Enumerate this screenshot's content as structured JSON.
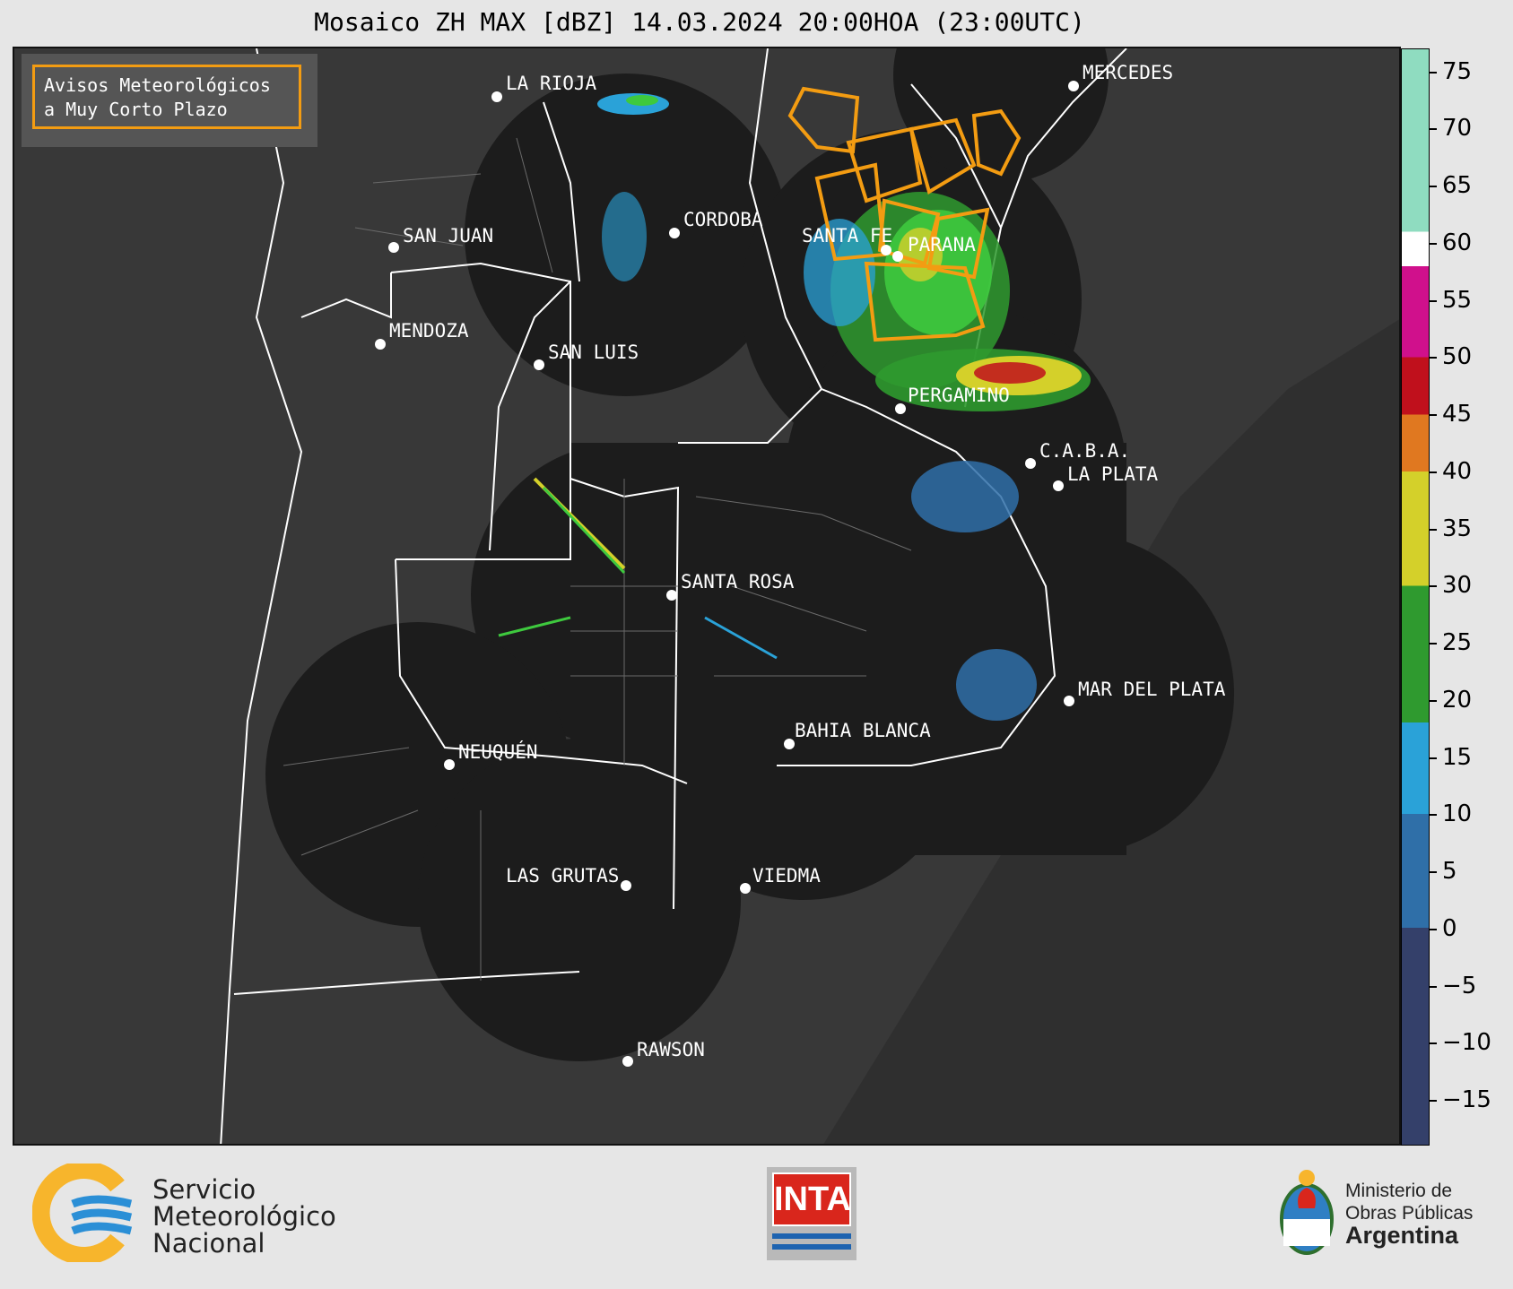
{
  "header": {
    "title": "Mosaico ZH MAX [dBZ] 14.03.2024 20:00HOA (23:00UTC)"
  },
  "alerts_box": {
    "line1": "Avisos Meteorológicos",
    "line2": "a Muy Corto Plazo",
    "border_color": "#f39c12"
  },
  "cities": [
    {
      "name": "LA RIOJA"
    },
    {
      "name": "MERCEDES"
    },
    {
      "name": "CORDOBA"
    },
    {
      "name": "SAN JUAN"
    },
    {
      "name": "SANTA FE"
    },
    {
      "name": "PARANA"
    },
    {
      "name": "MENDOZA"
    },
    {
      "name": "SAN LUIS"
    },
    {
      "name": "PERGAMINO"
    },
    {
      "name": "C.A.B.A."
    },
    {
      "name": "LA PLATA"
    },
    {
      "name": "SANTA ROSA"
    },
    {
      "name": "MAR DEL PLATA"
    },
    {
      "name": "BAHIA BLANCA"
    },
    {
      "name": "NEUQUÉN"
    },
    {
      "name": "LAS GRUTAS"
    },
    {
      "name": "VIEDMA"
    },
    {
      "name": "RAWSON"
    }
  ],
  "colorbar": {
    "unit": "dBZ",
    "min": -19,
    "max": 77,
    "ticks": [
      "75",
      "70",
      "65",
      "60",
      "55",
      "50",
      "45",
      "40",
      "35",
      "30",
      "25",
      "20",
      "15",
      "10",
      "5",
      "0",
      "−5",
      "−10",
      "−15"
    ],
    "tick_values": [
      75,
      70,
      65,
      60,
      55,
      50,
      45,
      40,
      35,
      30,
      25,
      20,
      15,
      10,
      5,
      0,
      -5,
      -10,
      -15
    ],
    "stops": [
      {
        "from": -19,
        "to": 0,
        "color": "#34406a"
      },
      {
        "from": 0,
        "to": 10,
        "color": "#2f6fa8"
      },
      {
        "from": 10,
        "to": 18,
        "color": "#2aa2d8"
      },
      {
        "from": 18,
        "to": 30,
        "color": "#2f9a2f"
      },
      {
        "from": 30,
        "to": 40,
        "color": "#d4d02a"
      },
      {
        "from": 40,
        "to": 45,
        "color": "#e07820"
      },
      {
        "from": 45,
        "to": 50,
        "color": "#c0101c"
      },
      {
        "from": 50,
        "to": 58,
        "color": "#d0108c"
      },
      {
        "from": 58,
        "to": 61,
        "color": "#ffffff"
      },
      {
        "from": 61,
        "to": 77,
        "color": "#8fdcc0"
      }
    ]
  },
  "footer": {
    "smn": {
      "line1": "Servicio",
      "line2": "Meteorológico",
      "line3": "Nacional"
    },
    "inta": {
      "label": "INTA"
    },
    "ministry": {
      "line1": "Ministerio de",
      "line2": "Obras Públicas",
      "line3": "Argentina"
    }
  }
}
